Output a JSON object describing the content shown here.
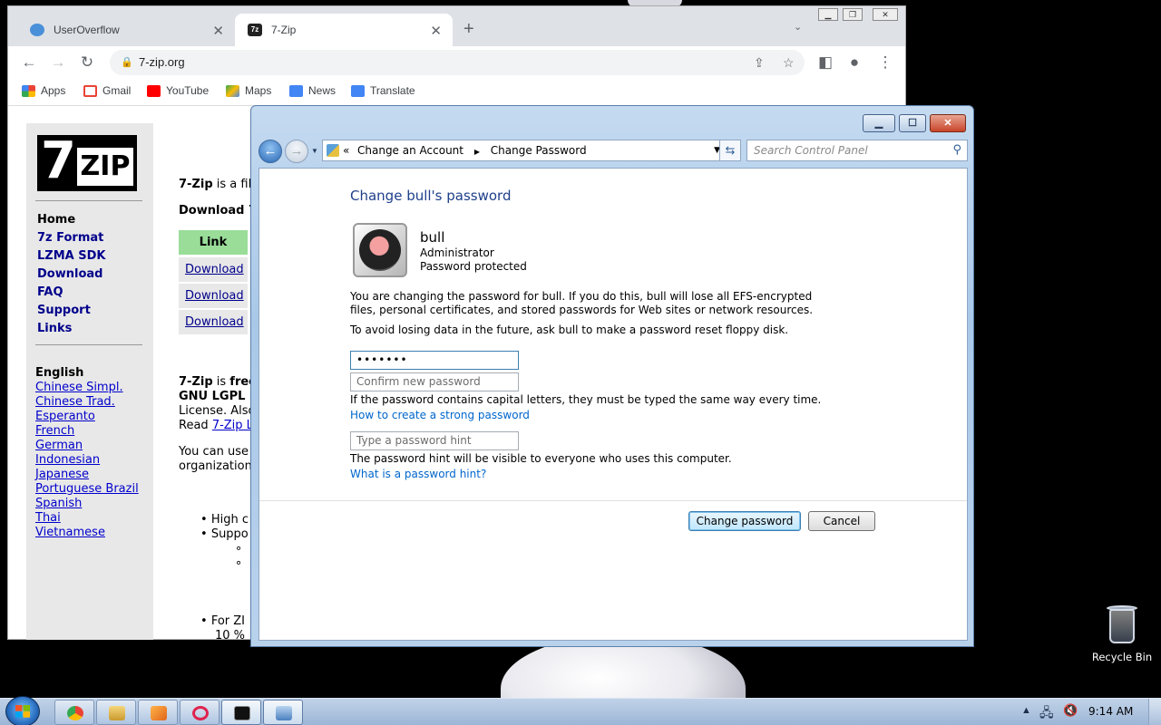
{
  "desktop": {
    "recycle_bin_label": "Recycle Bin"
  },
  "browser": {
    "tabs": [
      {
        "title": "UserOverflow",
        "icon": "useroverflow-favicon"
      },
      {
        "title": "7-Zip",
        "icon": "7zip-favicon"
      }
    ],
    "url": "7-zip.org",
    "bookmarks": [
      {
        "label": "Apps",
        "icon": "apps-grid-icon"
      },
      {
        "label": "Gmail",
        "icon": "gmail-icon"
      },
      {
        "label": "YouTube",
        "icon": "youtube-icon"
      },
      {
        "label": "Maps",
        "icon": "maps-icon"
      },
      {
        "label": "News",
        "icon": "news-icon"
      },
      {
        "label": "Translate",
        "icon": "translate-icon"
      }
    ]
  },
  "site": {
    "logo_seven": "7",
    "logo_zip": "ZIP",
    "nav": [
      "Home",
      "7z Format",
      "LZMA SDK",
      "Download",
      "FAQ",
      "Support",
      "Links"
    ],
    "languages_heading": "English",
    "languages": [
      "Chinese Simpl.",
      "Chinese Trad.",
      "Esperanto",
      "French",
      "German",
      "Indonesian",
      "Japanese",
      "Portuguese Brazil",
      "Spanish",
      "Thai",
      "Vietnamese"
    ],
    "intro_bold": "7-Zip",
    "intro_rest": " is a fil",
    "download_heading": "Download 7",
    "link_header": "Link",
    "download_links": [
      "Download",
      "Download",
      "Download"
    ],
    "free_bold": "7-Zip",
    "free_is": " is ",
    "free_bold2": "free",
    "license_line1": "GNU LGPL l",
    "license_line2": "License. Also",
    "license_line3": "Read ",
    "license_link": "7-Zip L",
    "use_line1": "You can use",
    "use_line2": "organization",
    "bullets": [
      "High c",
      "Suppo",
      "For ZI"
    ],
    "bullet_tail": "10 %"
  },
  "control_panel": {
    "breadcrumb": [
      "«",
      "Change an Account",
      "Change Password"
    ],
    "search_placeholder": "Search Control Panel",
    "title": "Change bull's password",
    "account_name": "bull",
    "account_type": "Administrator",
    "account_status": "Password protected",
    "warning": "You are changing the password for bull.  If you do this, bull will lose all EFS-encrypted files, personal certificates, and stored passwords for Web sites or network resources.",
    "advice": "To avoid losing data in the future, ask bull to make a password reset floppy disk.",
    "new_password_value": "•••••••",
    "confirm_placeholder": "Confirm new password",
    "caps_note": "If the password contains capital letters, they must be typed the same way every time.",
    "strong_link": "How to create a strong password",
    "hint_placeholder": "Type a password hint",
    "hint_note": "The password hint will be visible to everyone who uses this computer.",
    "hint_link": "What is a password hint?",
    "primary_button": "Change password",
    "cancel_button": "Cancel"
  },
  "taskbar": {
    "clock": "9:14 AM",
    "items": [
      "chrome-icon",
      "explorer-icon",
      "media-player-icon",
      "opera-icon",
      "cmd-icon",
      "control-panel-icon"
    ]
  }
}
